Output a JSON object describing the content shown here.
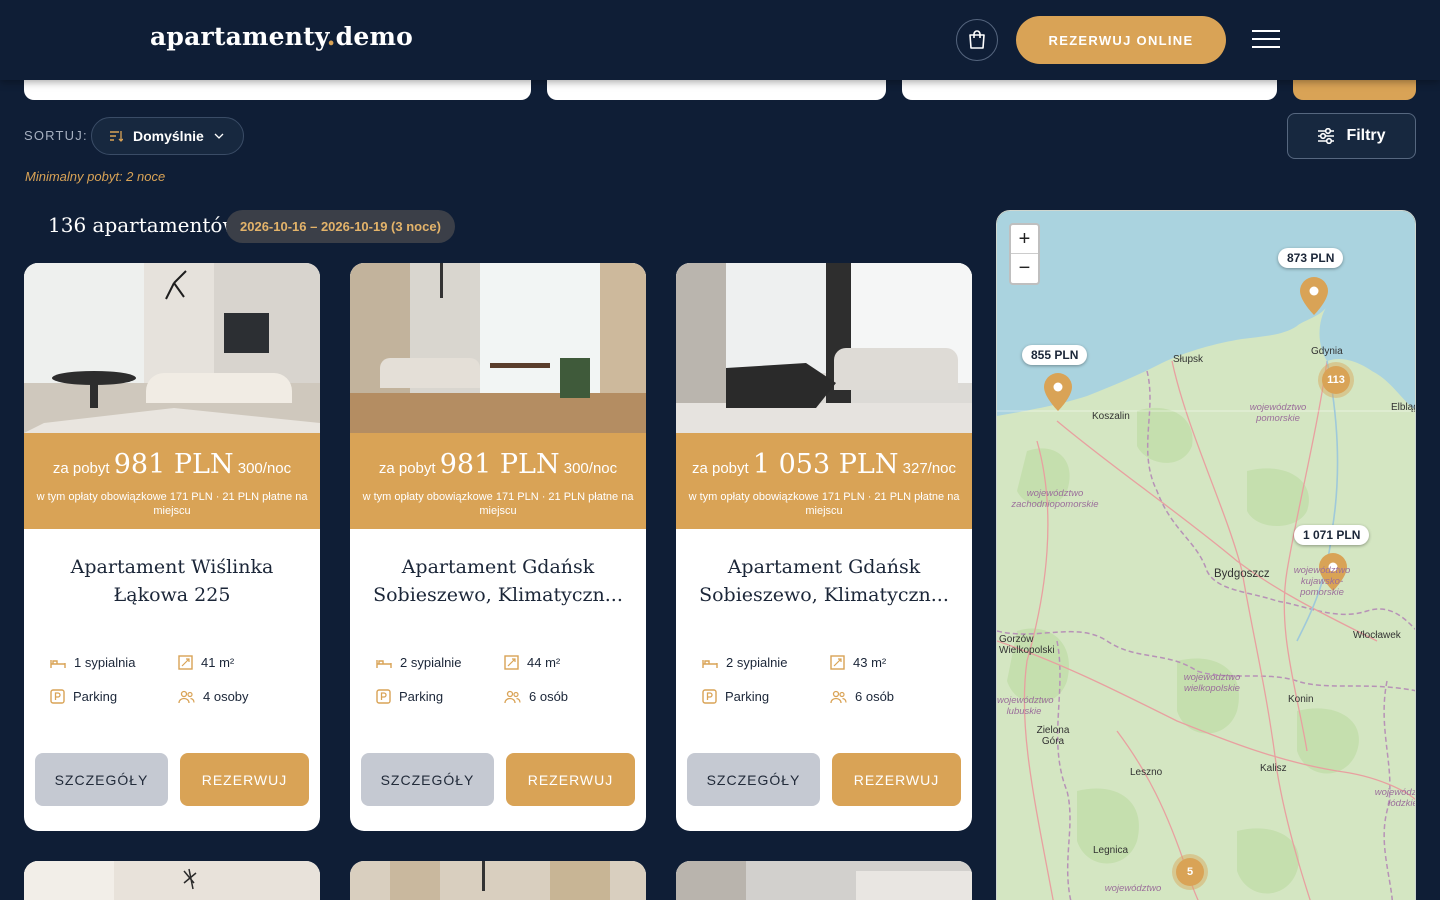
{
  "header": {
    "logo_main": "apartamenty",
    "logo_dot": ".",
    "logo_tld": "demo",
    "book_online": "REZERWUJ ONLINE",
    "cart_icon": "cart-icon",
    "menu_icon": "hamburger-icon"
  },
  "toolbar": {
    "sort_label": "SORTUJ:",
    "sort_value": "Domyślnie",
    "filters_label": "Filtry",
    "min_stay": "Minimalny pobyt: 2 noce"
  },
  "results": {
    "count": "136 apartamentów",
    "dates": "2026-10-16 – 2026-10-19 (3 noce)"
  },
  "cards": [
    {
      "price_prefix": "za pobyt",
      "price": "981 PLN",
      "per_night": "300/noc",
      "fees": "w tym opłaty obowiązkowe 171 PLN · 21 PLN płatne na miejscu",
      "title_line1": "Apartament Wiślinka",
      "title_line2": "Łąkowa 225",
      "bedrooms": "1 sypialnia",
      "area": "41 m²",
      "parking": "Parking",
      "guests": "4 osoby",
      "details": "SZCZEGÓŁY",
      "book": "REZERWUJ"
    },
    {
      "price_prefix": "za pobyt",
      "price": "981 PLN",
      "per_night": "300/noc",
      "fees": "w tym opłaty obowiązkowe 171 PLN · 21 PLN płatne na miejscu",
      "title_line1": "Apartament Gdańsk",
      "title_line2": "Sobieszewo, Klimatyczn...",
      "bedrooms": "2 sypialnie",
      "area": "44 m²",
      "parking": "Parking",
      "guests": "6 osób",
      "details": "SZCZEGÓŁY",
      "book": "REZERWUJ"
    },
    {
      "price_prefix": "za pobyt",
      "price": "1 053 PLN",
      "per_night": "327/noc",
      "fees": "w tym opłaty obowiązkowe 171 PLN · 21 PLN płatne na miejscu",
      "title_line1": "Apartament Gdańsk",
      "title_line2": "Sobieszewo, Klimatyczn...",
      "bedrooms": "2 sypialnie",
      "area": "43 m²",
      "parking": "Parking",
      "guests": "6 osób",
      "details": "SZCZEGÓŁY",
      "book": "REZERWUJ"
    }
  ],
  "map": {
    "zoom_in": "+",
    "zoom_out": "−",
    "price_pins": [
      "873 PLN",
      "855 PLN",
      "1 071 PLN"
    ],
    "clusters": [
      "113",
      "5"
    ],
    "places": [
      "Słupsk",
      "Gdynia",
      "Koszalin",
      "Elbląg",
      "Bydgoszcz",
      "Włocławek",
      "Gorzów Wielkopolski",
      "Konin",
      "Zielona Góra",
      "Leszno",
      "Kalisz",
      "Legnica"
    ],
    "regions": [
      "województwo pomorskie",
      "województwo zachodniopomorskie",
      "województwo kujawsko-pomorskie",
      "województwo wielkopolskie",
      "województwo lubuskie",
      "województwo łódzkie",
      "województwo"
    ]
  },
  "colors": {
    "background": "#0f1e36",
    "accent": "#d9a356",
    "card": "#ffffff",
    "details_button": "#c5c9d2"
  }
}
